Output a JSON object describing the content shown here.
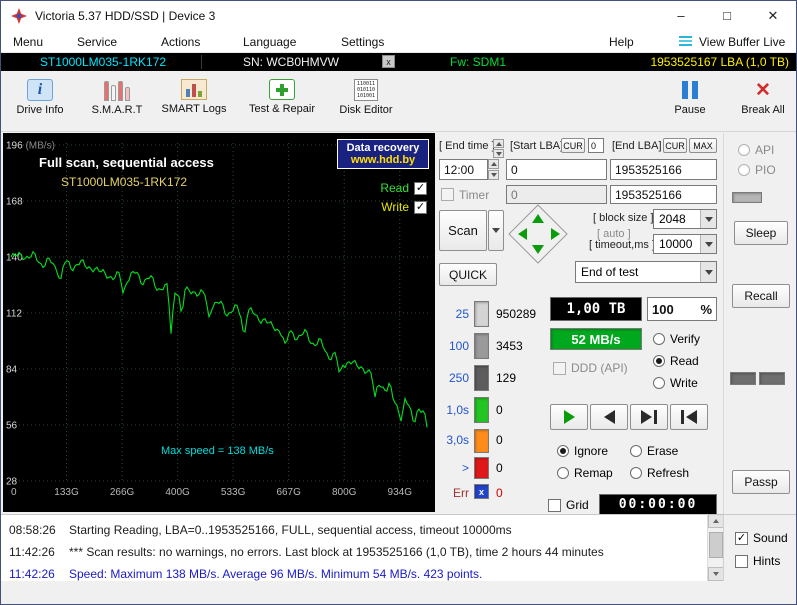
{
  "window": {
    "title": "Victoria 5.37 HDD/SSD | Device 3"
  },
  "icons": {
    "check": "✓",
    "close": "✕",
    "minimize": "–",
    "maximize": "□",
    "small_x": "x",
    "info": "i",
    "binary": [
      "110011",
      "010110",
      "101001"
    ]
  },
  "menu": {
    "items": [
      "Menu",
      "Service",
      "Actions",
      "Language",
      "Settings",
      "Help"
    ],
    "view_buffer": "View Buffer Live"
  },
  "info_bar": {
    "model": "ST1000LM035-1RK172",
    "serial": "SN: WCB0HMVW",
    "firmware": "Fw: SDM1",
    "lba": "1953525167 LBA (1,0 TB)"
  },
  "toolbar": {
    "drive_info": "Drive Info",
    "smart": "S.M.A.R.T",
    "smart_logs": "SMART Logs",
    "test_repair": "Test & Repair",
    "disk_editor": "Disk Editor",
    "pause": "Pause",
    "break_all": "Break All"
  },
  "graph": {
    "title": "Full scan, sequential access",
    "subtitle": "ST1000LM035-1RK172",
    "badge": {
      "line1": "Data recovery",
      "line2": "www.hdd.by"
    },
    "read_label": "Read",
    "write_label": "Write",
    "max_speed_note": "Max speed = 138 MB/s",
    "y_unit": "(MB/s)",
    "y_labels": [
      "196",
      "168",
      "140",
      "112",
      "84",
      "56",
      "28"
    ],
    "x_labels": [
      "0",
      "133G",
      "266G",
      "400G",
      "533G",
      "667G",
      "800G",
      "934G"
    ],
    "line_color": "#00e020",
    "curve": {
      "type": "line",
      "y_range_mbs": [
        28,
        196
      ],
      "x_range_gb": [
        0,
        1000
      ],
      "anchors": [
        [
          0,
          140
        ],
        [
          0.04,
          139
        ],
        [
          0.1,
          137.5
        ],
        [
          0.16,
          135
        ],
        [
          0.22,
          133
        ],
        [
          0.28,
          130
        ],
        [
          0.34,
          127
        ],
        [
          0.4,
          124
        ],
        [
          0.46,
          120
        ],
        [
          0.52,
          115
        ],
        [
          0.58,
          110
        ],
        [
          0.64,
          105
        ],
        [
          0.7,
          100
        ],
        [
          0.76,
          93
        ],
        [
          0.82,
          87
        ],
        [
          0.88,
          78
        ],
        [
          0.93,
          70
        ],
        [
          0.97,
          62
        ],
        [
          1,
          55
        ]
      ],
      "spikes": [
        {
          "frac": 0.12,
          "drop": 7
        },
        {
          "frac": 0.27,
          "drop": 9
        },
        {
          "frac": 0.385,
          "drop": 22
        },
        {
          "frac": 0.41,
          "drop": 14
        },
        {
          "frac": 0.475,
          "drop": 10
        },
        {
          "frac": 0.56,
          "drop": 11
        },
        {
          "frac": 0.66,
          "drop": 8
        },
        {
          "frac": 0.79,
          "drop": 9
        },
        {
          "frac": 0.875,
          "drop": 12
        },
        {
          "frac": 0.94,
          "drop": 8
        }
      ],
      "stats": {
        "max_mbs": 138,
        "avg_mbs": 96,
        "min_mbs": 54,
        "points": 423
      }
    }
  },
  "controls": {
    "end_time_label": "[ End time ]",
    "end_time_value": "12:00",
    "start_lba_label": "[Start LBA]",
    "cur_label": "CUR",
    "start_lba_cur": "0",
    "start_lba_value": "0",
    "end_lba_label": "[End LBA]",
    "max_label": "MAX",
    "end_lba_value": "1953525166",
    "timer_label": "Timer",
    "timer_value": "0",
    "end_lba_value2": "1953525166",
    "scan_label": "Scan",
    "block_size_label": "[ block size ]",
    "auto_label": "[ auto ]",
    "block_size_value": "2048",
    "timeout_label": "[ timeout,ms ]",
    "timeout_value": "10000",
    "quick_label": "QUICK",
    "end_of_test_value": "End of test",
    "speed_rows": [
      {
        "label": "25",
        "count": "950289",
        "color": "#d4d4d4"
      },
      {
        "label": "100",
        "count": "3453",
        "color": "#9a9a9a"
      },
      {
        "label": "250",
        "count": "129",
        "color": "#5c5c5c"
      },
      {
        "label": "1,0s",
        "count": "0",
        "color": "#22c522"
      },
      {
        "label": "3,0s",
        "count": "0",
        "color": "#ff8c1a"
      },
      {
        "label": ">",
        "count": "0",
        "color": "#e01818"
      },
      {
        "label": "Err",
        "count": "0",
        "color": "#2244cc"
      }
    ],
    "capacity_value": "1,00 TB",
    "percent_value": "100",
    "percent_unit": "%",
    "speed_value": "52 MB/s",
    "speed_bg": "#00a81e",
    "ddd_label": "DDD (API)",
    "mode_verify": "Verify",
    "mode_read": "Read",
    "mode_write": "Write",
    "act_ignore": "Ignore",
    "act_erase": "Erase",
    "act_remap": "Remap",
    "act_refresh": "Refresh",
    "grid_label": "Grid",
    "elapsed_value": "00:00:00"
  },
  "side": {
    "api": "API",
    "pio": "PIO",
    "sleep": "Sleep",
    "recall": "Recall",
    "passp": "Passp"
  },
  "log": {
    "entries": [
      {
        "time": "08:58:26",
        "text": "Starting Reading, LBA=0..1953525166, FULL, sequential access, timeout 10000ms"
      },
      {
        "time": "11:42:26",
        "text": "*** Scan results: no warnings, no errors. Last block at 1953525166 (1,0 TB), time 2 hours 44 minutes"
      },
      {
        "time": "11:42:26",
        "text": "Speed: Maximum 138 MB/s. Average 96 MB/s. Minimum 54 MB/s. 423 points."
      }
    ]
  },
  "footer": {
    "sound": "Sound",
    "hints": "Hints"
  }
}
